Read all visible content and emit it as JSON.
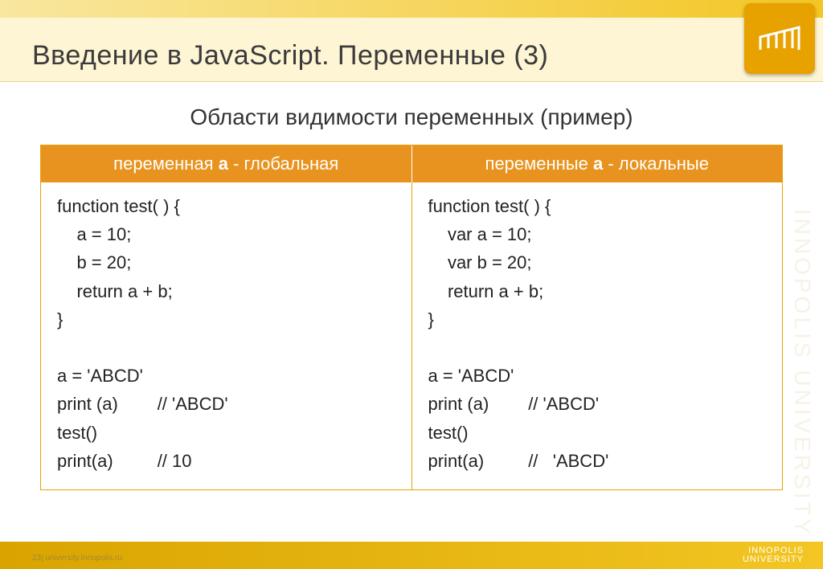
{
  "title": "Введение в JavaScript. Переменные (3)",
  "subtitle": "Области видимости переменных (пример)",
  "columns": {
    "left": {
      "header_prefix": "переменная ",
      "header_bold": "a",
      "header_suffix": " - глобальная",
      "code": "function test( ) {\n    a = 10;\n    b = 20;\n    return a + b;\n}\n\na = 'ABCD'\nprint (a)        // 'ABCD'\ntest()\nprint(a)         // 10"
    },
    "right": {
      "header_prefix": "переменные ",
      "header_bold": "a",
      "header_suffix": " - локальные",
      "code": "function test( ) {\n    var a = 10;\n    var b = 20;\n    return a + b;\n}\n\na = 'ABCD'\nprint (a)        // 'ABCD'\ntest()\nprint(a)         //   'ABCD'"
    }
  },
  "footer": "23| university.innopolis.ru",
  "footer_logo_line1": "INNOPOLIS",
  "footer_logo_line2": "UNIVERSITY",
  "watermark": "INNOPOLIS UNIVERSITY"
}
